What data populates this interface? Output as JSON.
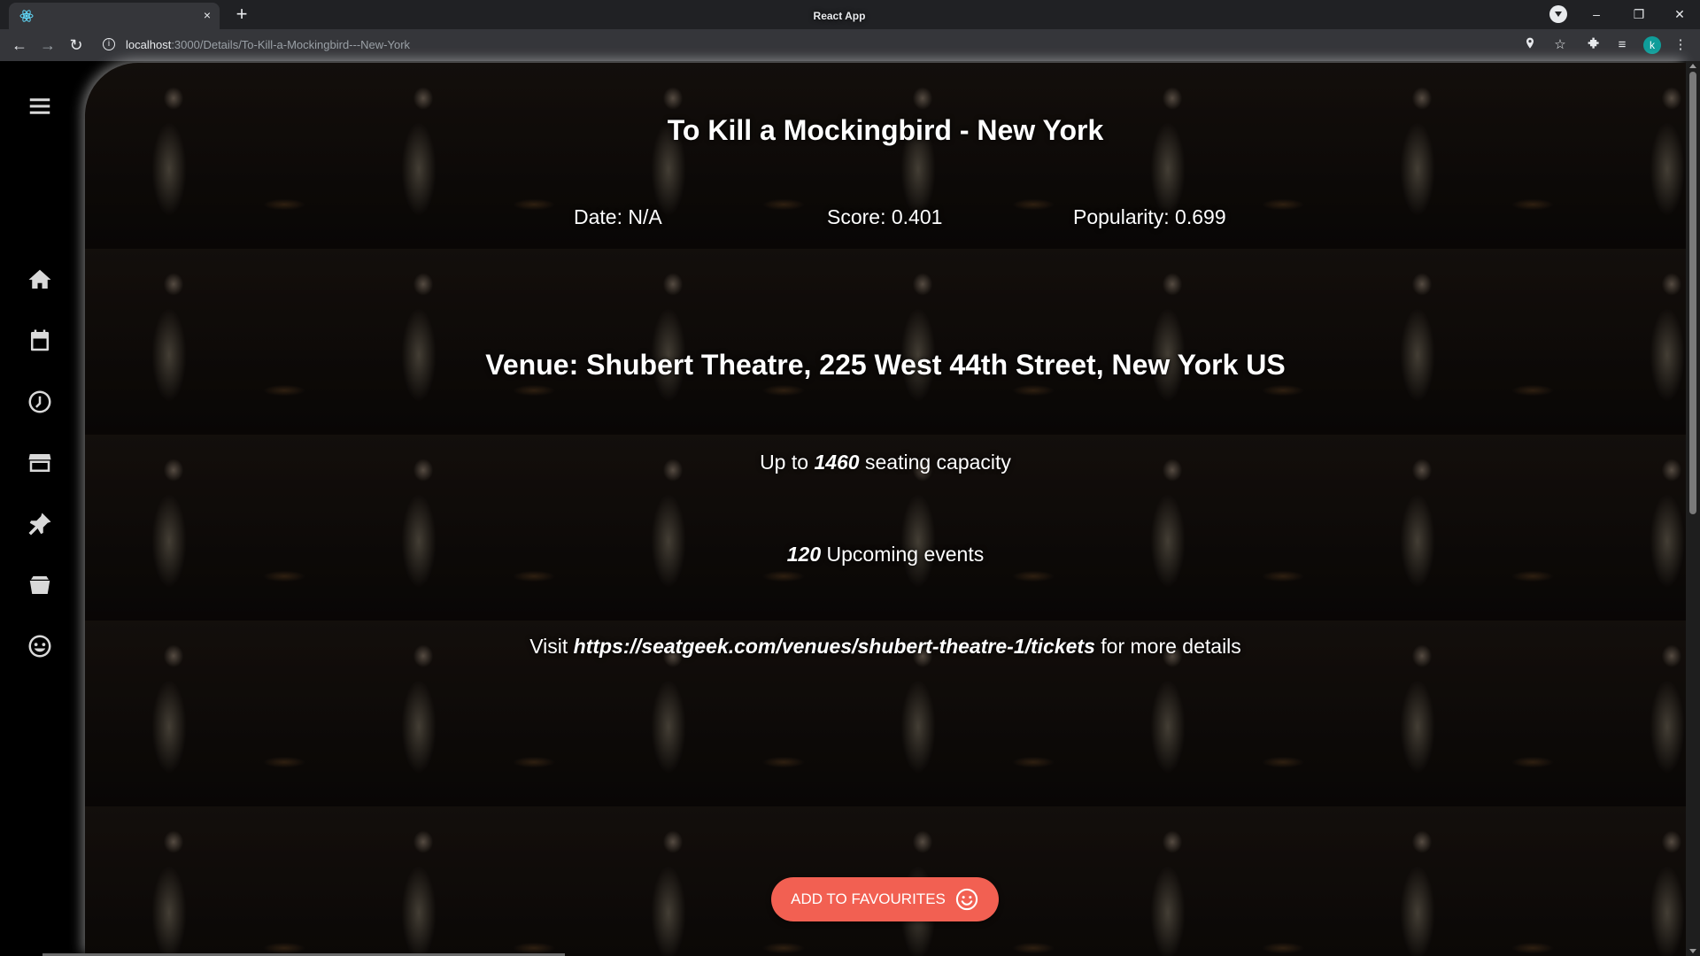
{
  "browser": {
    "tab_title": "React App",
    "tab_close": "×",
    "new_tab": "+",
    "url_host": "localhost",
    "url_path": ":3000/Details/To-Kill-a-Mockingbird---New-York",
    "profile_initial": "k",
    "window_controls": {
      "minimize": "–",
      "restore": "❐",
      "close": "✕"
    }
  },
  "sidebar": {
    "items": [
      {
        "icon": "menu-icon"
      },
      {
        "icon": "home-icon"
      },
      {
        "icon": "calendar-icon"
      },
      {
        "icon": "clock-icon"
      },
      {
        "icon": "store-icon"
      },
      {
        "icon": "pin-icon"
      },
      {
        "icon": "basket-icon"
      },
      {
        "icon": "smiley-icon"
      }
    ]
  },
  "event": {
    "title": "To Kill a Mockingbird - New York",
    "date": "Date: N/A",
    "score": "Score: 0.401",
    "popularity": "Popularity: 0.699",
    "venue": "Venue: Shubert Theatre, 225 West 44th Street, New York US",
    "capacity_prefix": "Up to",
    "capacity_value": "1460",
    "capacity_suffix": "seating capacity",
    "events_value": "120",
    "events_suffix": "Upcoming events",
    "visit_prefix": "Visit",
    "visit_url": "https://seatgeek.com/venues/shubert-theatre-1/tickets",
    "visit_suffix": "for more details"
  },
  "actions": {
    "add_favourites": "ADD TO FAVOURITES"
  },
  "colors": {
    "button": "#f26052",
    "background": "#000000",
    "text": "#ffffff"
  }
}
